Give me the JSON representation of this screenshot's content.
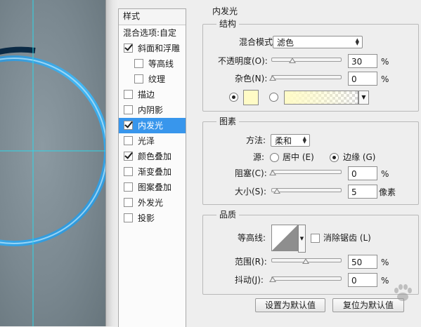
{
  "style_panel": {
    "title": "样式",
    "blend_options": "混合选项:自定",
    "items": [
      {
        "label": "斜面和浮雕",
        "checked": true
      },
      {
        "label": "等高线",
        "checked": false
      },
      {
        "label": "纹理",
        "checked": false
      },
      {
        "label": "描边",
        "checked": false
      },
      {
        "label": "内阴影",
        "checked": false
      },
      {
        "label": "内发光",
        "checked": true
      },
      {
        "label": "光泽",
        "checked": false
      },
      {
        "label": "颜色叠加",
        "checked": true
      },
      {
        "label": "渐变叠加",
        "checked": false
      },
      {
        "label": "图案叠加",
        "checked": false
      },
      {
        "label": "外发光",
        "checked": false
      },
      {
        "label": "投影",
        "checked": false
      }
    ]
  },
  "section_title": "内发光",
  "structure": {
    "title": "结构",
    "blend_mode_label": "混合模式:",
    "blend_mode_value": "滤色",
    "opacity_label": "不透明度(O):",
    "opacity_value": "30",
    "opacity_percent": 30,
    "noise_label": "杂色(N):",
    "noise_value": "0",
    "noise_percent": 0,
    "unit_percent": "%",
    "glow_color": "#fffbc6"
  },
  "elements": {
    "title": "图素",
    "method_label": "方法:",
    "method_value": "柔和",
    "source_label": "源:",
    "source_center": "居中 (E)",
    "source_edge": "边缘 (G)",
    "choke_label": "阻塞(C):",
    "choke_value": "0",
    "choke_percent": 0,
    "size_label": "大小(S):",
    "size_value": "5",
    "size_unit": "像素"
  },
  "quality": {
    "title": "品质",
    "contour_label": "等高线:",
    "anti_alias_label": "消除锯齿 (L)",
    "range_label": "范围(R):",
    "range_value": "50",
    "range_percent": 50,
    "jitter_label": "抖动(J):",
    "jitter_value": "0",
    "jitter_percent": 0
  },
  "buttons": {
    "make_default": "设置为默认值",
    "reset_default": "复位为默认值"
  },
  "colors": {
    "selection": "#3896ec",
    "ring": "#3aa6e6",
    "guide": "#2fd6e8"
  }
}
